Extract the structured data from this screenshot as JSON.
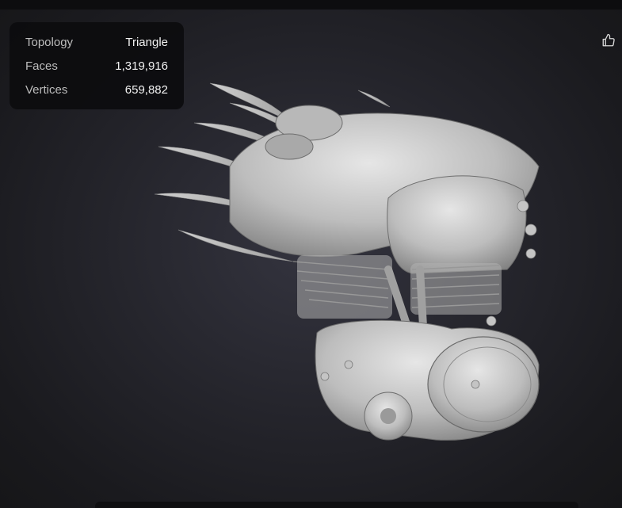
{
  "stats": {
    "topology_label": "Topology",
    "topology_value": "Triangle",
    "faces_label": "Faces",
    "faces_value": "1,319,916",
    "vertices_label": "Vertices",
    "vertices_value": "659,882"
  },
  "toolbar": {
    "like_icon": "thumbs-up-icon"
  },
  "viewport": {
    "model": "engine-3d-model",
    "model_color": "#c9c9c9",
    "background_color": "#25252c"
  },
  "colors": {
    "panel_bg": "#0c0c0e",
    "label_text": "#bdbdbd",
    "value_text": "#f2f2f2"
  }
}
